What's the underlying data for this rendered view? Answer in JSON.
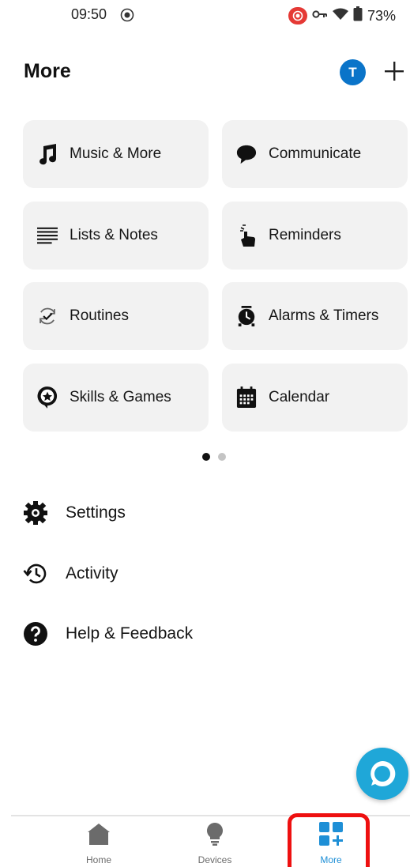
{
  "status_bar": {
    "time": "09:50",
    "battery": "73%"
  },
  "header": {
    "title": "More",
    "avatar_initial": "T"
  },
  "tiles": [
    {
      "label": "Music & More",
      "icon": "music-note-icon"
    },
    {
      "label": "Communicate",
      "icon": "chat-bubble-icon"
    },
    {
      "label": "Lists & Notes",
      "icon": "list-icon"
    },
    {
      "label": "Reminders",
      "icon": "reminder-hand-icon"
    },
    {
      "label": "Routines",
      "icon": "routine-icon"
    },
    {
      "label": "Alarms & Timers",
      "icon": "alarm-clock-icon"
    },
    {
      "label": "Skills & Games",
      "icon": "skills-icon"
    },
    {
      "label": "Calendar",
      "icon": "calendar-icon"
    }
  ],
  "pager": {
    "pages": 2,
    "active": 1
  },
  "menu": [
    {
      "label": "Settings",
      "icon": "gear-icon"
    },
    {
      "label": "Activity",
      "icon": "history-icon"
    },
    {
      "label": "Help & Feedback",
      "icon": "help-icon"
    }
  ],
  "bottom_nav": [
    {
      "label": "Home",
      "icon": "home-icon",
      "active": false
    },
    {
      "label": "Devices",
      "icon": "bulb-icon",
      "active": false
    },
    {
      "label": "More",
      "icon": "more-grid-icon",
      "active": true
    }
  ],
  "colors": {
    "accent": "#1e8fd6",
    "inactive": "#6b6b6b",
    "avatar": "#0a74c9",
    "fab": "#1fa7d8",
    "highlight": "#ee1010"
  }
}
